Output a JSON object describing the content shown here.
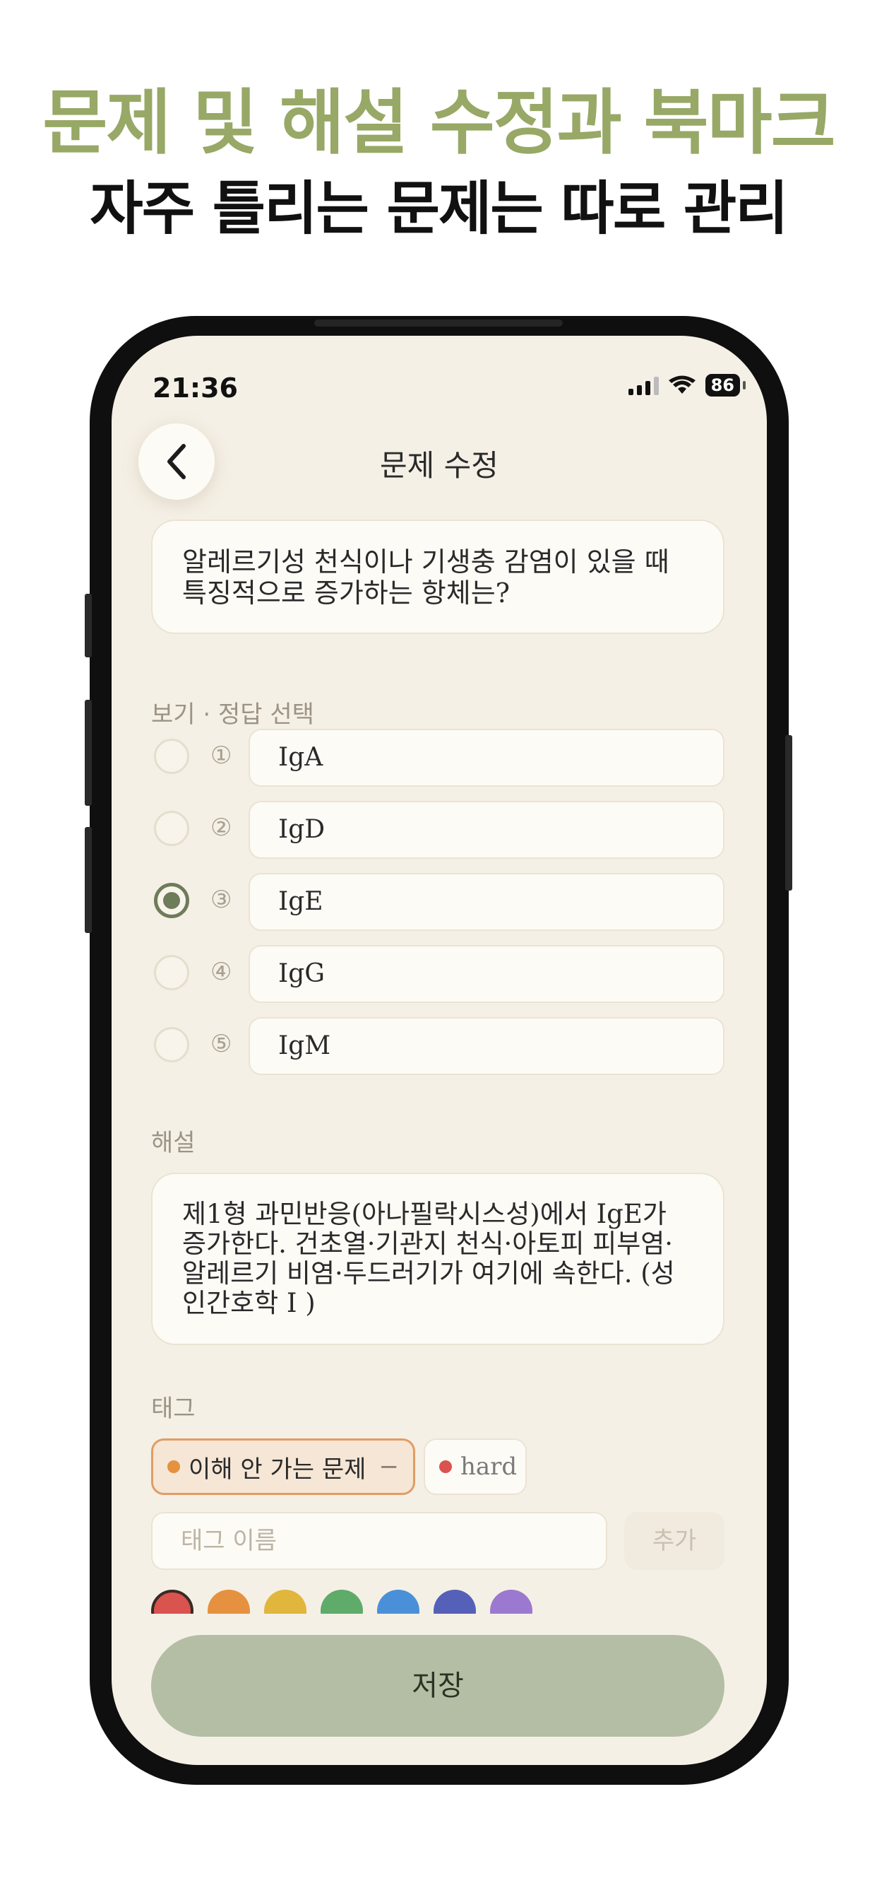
{
  "promo": {
    "headline": "문제 및 해설 수정과 북마크",
    "subheadline": "자주 틀리는 문제는 따로 관리"
  },
  "status_bar": {
    "time": "21:36",
    "battery": "86"
  },
  "header": {
    "title": "문제 수정"
  },
  "question": {
    "text": "알레르기성 천식이나 기생충 감염이 있을 때 특징적으로 증가하는 항체는?"
  },
  "options": {
    "section_label": "보기 · 정답 선택",
    "items": [
      {
        "number": "①",
        "value": "IgA",
        "selected": false
      },
      {
        "number": "②",
        "value": "IgD",
        "selected": false
      },
      {
        "number": "③",
        "value": "IgE",
        "selected": true
      },
      {
        "number": "④",
        "value": "IgG",
        "selected": false
      },
      {
        "number": "⑤",
        "value": "IgM",
        "selected": false
      }
    ]
  },
  "explanation": {
    "label": "해설",
    "text": "제1형 과민반응(아나필락시스성)에서 IgE가 증가한다. 건초열·기관지 천식·아토피 피부염·알레르기 비염·두드러기가 여기에 속한다. (성인간호학 I )"
  },
  "tags": {
    "label": "태그",
    "items": [
      {
        "label": "이해 안 가는 문제",
        "remove": "−",
        "color": "#e5913f"
      },
      {
        "label": "hard",
        "color": "#d9534f"
      }
    ],
    "input_placeholder": "태그 이름",
    "add_label": "추가",
    "palette": [
      "#d9534f",
      "#e5913f",
      "#e0b63c",
      "#5eab6a",
      "#4a90d9",
      "#5560b8",
      "#9b79d0"
    ]
  },
  "footer": {
    "save_label": "저장"
  },
  "colors": {
    "accent": "#98a866",
    "background": "#f5f0e6",
    "save_button": "#b3bea4",
    "selected_radio": "#6f7c5a"
  }
}
